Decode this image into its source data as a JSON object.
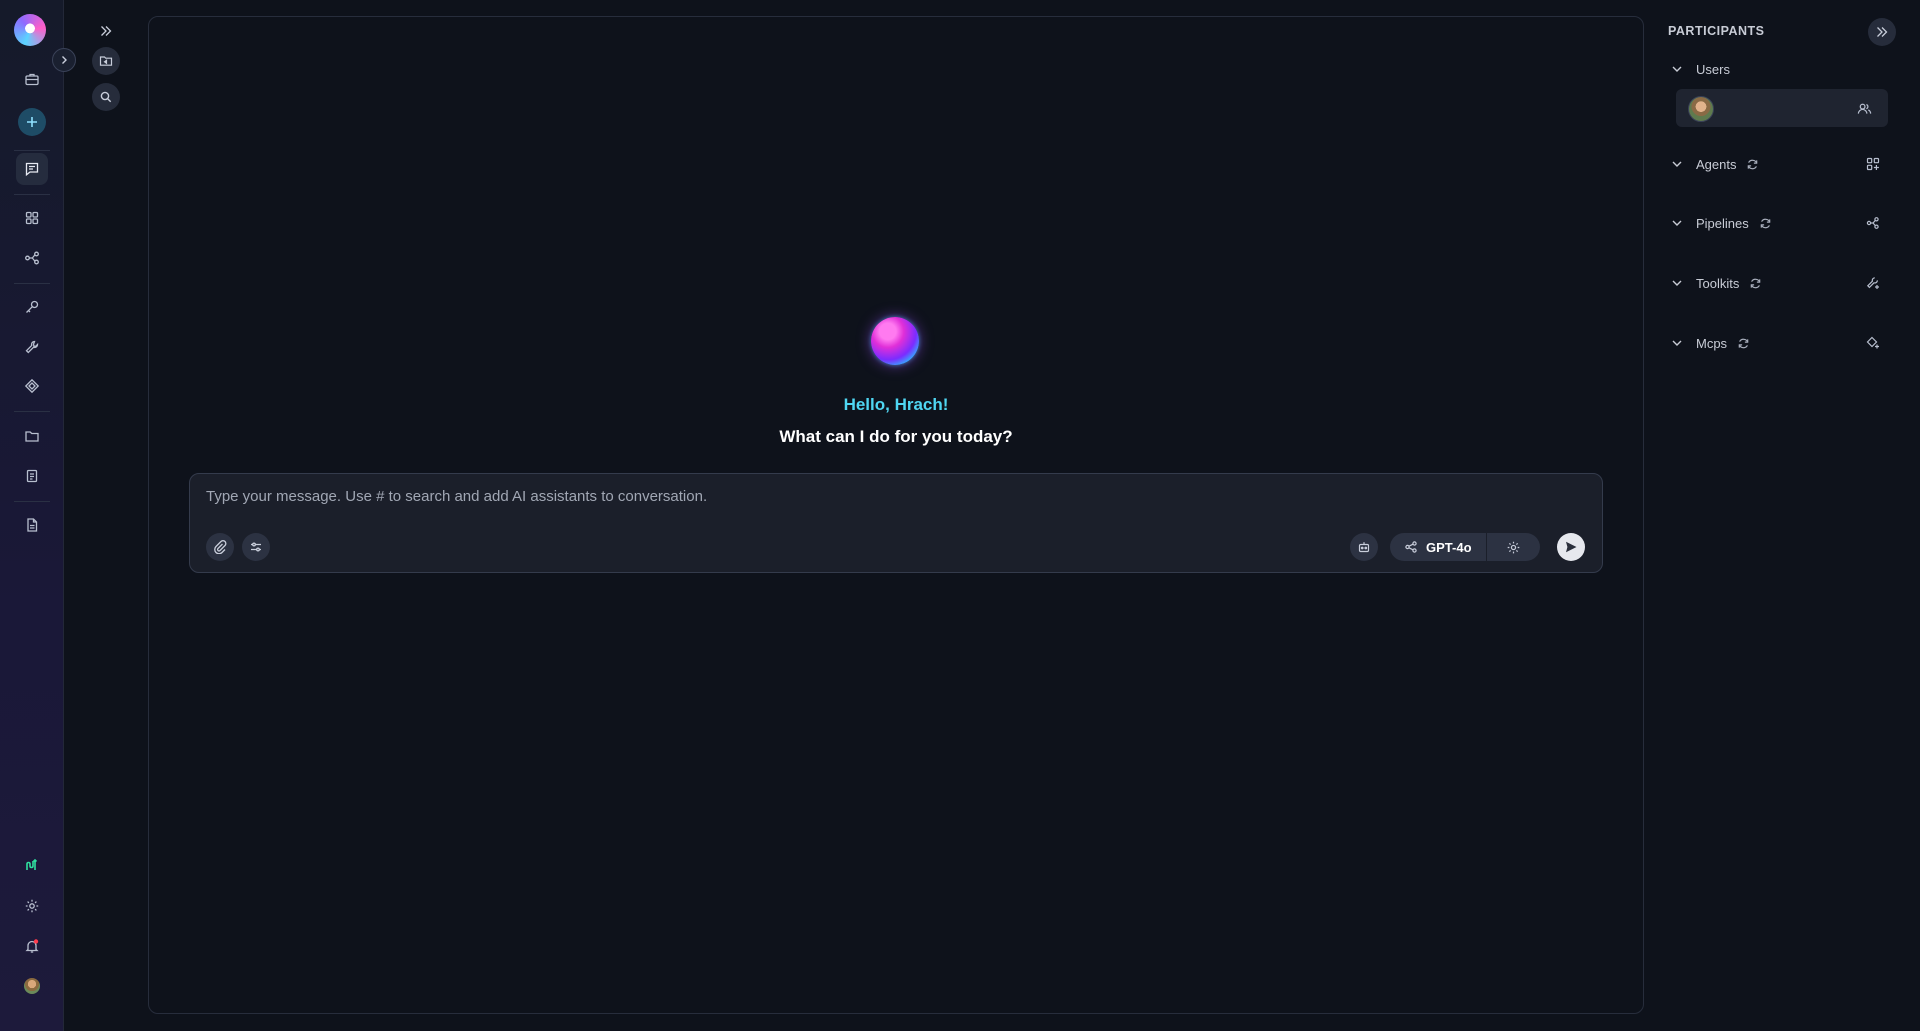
{
  "sidebar": {
    "items": [
      {
        "name": "briefcase",
        "icon": "briefcase-icon"
      },
      {
        "name": "new",
        "icon": "plus-icon"
      },
      {
        "name": "chat",
        "icon": "chat-icon",
        "active": true
      },
      {
        "name": "applications",
        "icon": "grid-icon"
      },
      {
        "name": "pipelines",
        "icon": "pipeline-icon"
      },
      {
        "name": "credentials",
        "icon": "key-icon"
      },
      {
        "name": "toolkits",
        "icon": "wrench-icon"
      },
      {
        "name": "mcps",
        "icon": "diamond-icon"
      },
      {
        "name": "folders",
        "icon": "folder-icon"
      },
      {
        "name": "documents",
        "icon": "document-stack-icon"
      },
      {
        "name": "notes",
        "icon": "note-icon"
      }
    ],
    "bottom": [
      {
        "name": "analytics",
        "icon": "analytics-icon",
        "color": "#2fe0a0"
      },
      {
        "name": "settings",
        "icon": "gear-icon"
      },
      {
        "name": "notifications",
        "icon": "bell-icon",
        "badge_color": "#ff3b4d"
      },
      {
        "name": "profile",
        "icon": "avatar"
      }
    ]
  },
  "chat": {
    "greeting": "Hello, Hrach!",
    "question": "What can I do for you today?",
    "input_placeholder": "Type your message. Use # to search and add AI assistants to conversation.",
    "input_value": "",
    "model": "GPT-4o"
  },
  "participants": {
    "title": "PARTICIPANTS",
    "sections": [
      {
        "label": "Users"
      },
      {
        "label": "Agents"
      },
      {
        "label": "Pipelines"
      },
      {
        "label": "Toolkits"
      },
      {
        "label": "Mcps"
      }
    ]
  },
  "colors": {
    "accent": "#4fd6f2",
    "background": "#0e121b",
    "panel": "#1b1f2a",
    "notification": "#ff3b4d",
    "analytics": "#2fe0a0"
  }
}
